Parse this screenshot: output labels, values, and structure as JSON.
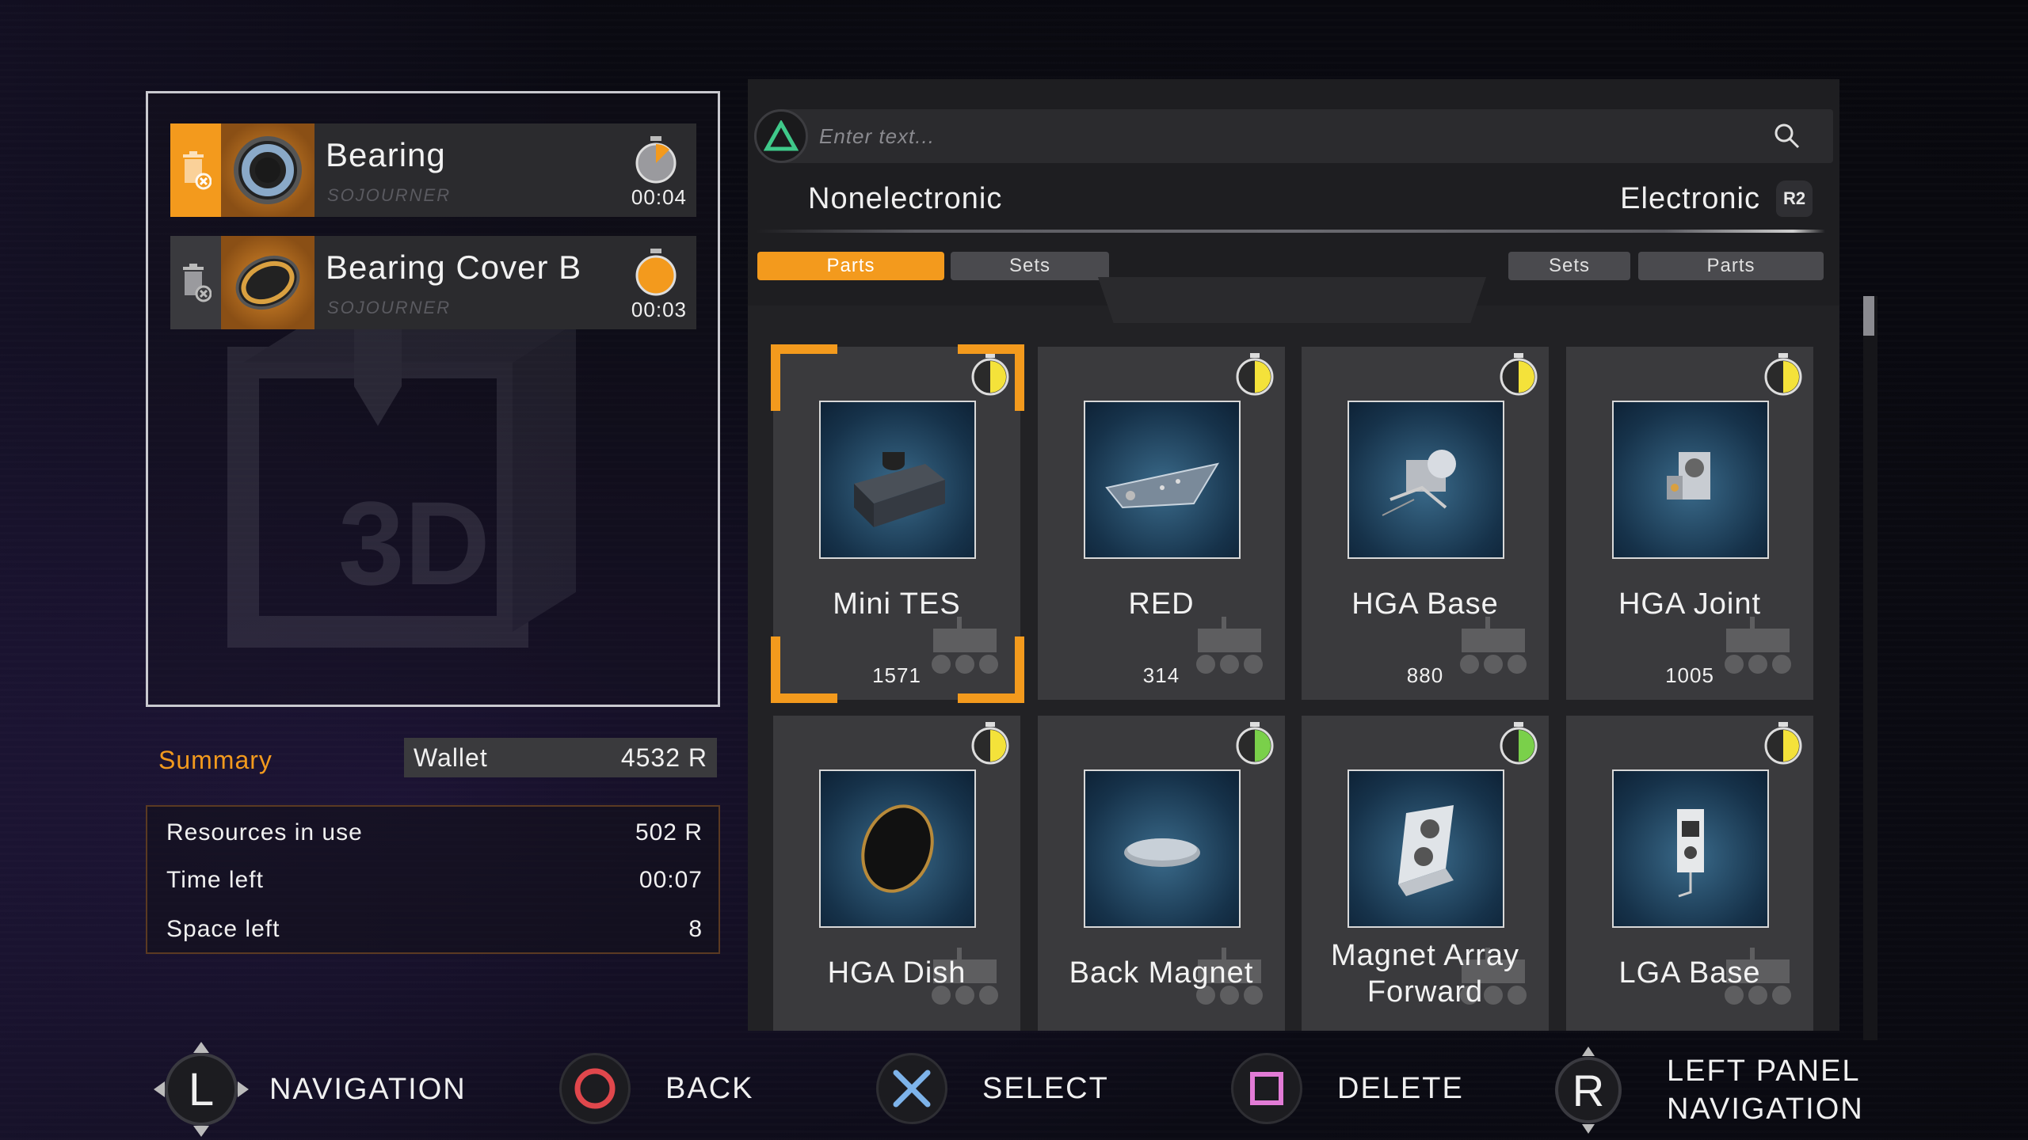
{
  "queue": {
    "items": [
      {
        "name": "Bearing",
        "source": "SOJOURNER",
        "time": "00:04",
        "selected": true
      },
      {
        "name": "Bearing Cover B",
        "source": "SOJOURNER",
        "time": "00:03",
        "selected": false
      }
    ]
  },
  "summary": {
    "label": "Summary",
    "wallet_label": "Wallet",
    "wallet_value": "4532 R",
    "rows": [
      {
        "label": "Resources in use",
        "value": "502 R"
      },
      {
        "label": "Time left",
        "value": "00:07"
      },
      {
        "label": "Space left",
        "value": "8"
      }
    ]
  },
  "search": {
    "placeholder": "Enter text..."
  },
  "categories": {
    "left": "Nonelectronic",
    "right": "Electronic",
    "right_button": "R2",
    "left_tabs": [
      "Parts",
      "Sets"
    ],
    "right_tabs": [
      "Sets",
      "Parts"
    ],
    "active_tab": "Parts"
  },
  "parts": [
    {
      "name": "Mini TES",
      "cost": "1571"
    },
    {
      "name": "RED",
      "cost": "314"
    },
    {
      "name": "HGA Base",
      "cost": "880"
    },
    {
      "name": "HGA Joint",
      "cost": "1005"
    },
    {
      "name": "HGA Dish",
      "cost": ""
    },
    {
      "name": "Back Magnet",
      "cost": ""
    },
    {
      "name": "Magnet Array Forward",
      "cost": ""
    },
    {
      "name": "LGA Base",
      "cost": ""
    }
  ],
  "hints": {
    "navigation": "NAVIGATION",
    "back": "BACK",
    "select": "SELECT",
    "delete": "DELETE",
    "left_panel_1": "LEFT PANEL",
    "left_panel_2": "NAVIGATION",
    "l_key": "L",
    "r_key": "R"
  },
  "colors": {
    "accent": "#f39a1d",
    "panel": "#3a3a3d",
    "circle": "#e0474c",
    "cross": "#7db3ea",
    "square": "#e27bd6",
    "triangle": "#3fc98a"
  }
}
